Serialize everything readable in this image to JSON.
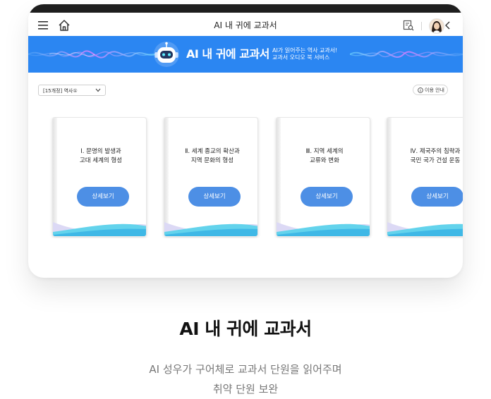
{
  "appbar": {
    "title": "AI 내 귀에 교과서",
    "icons": [
      "menu-icon",
      "home-icon",
      "search-doc-icon",
      "avatar",
      "chevron-left-icon"
    ]
  },
  "banner": {
    "title": "AI 내 귀에 교과서",
    "subtitle_line1": "AI가 읽어주는 역사 교과서!",
    "subtitle_line2": "교과서 오디오 북 서비스"
  },
  "toolbar": {
    "select_value": "[15개정] 역사①",
    "guide_label": "이용 안내"
  },
  "cards": [
    {
      "title": "Ⅰ. 문명의 발생과\n고대 세계의 형성",
      "button": "상세보기"
    },
    {
      "title": "Ⅱ. 세계 종교의 확산과\n지역 문화의 형성",
      "button": "상세보기"
    },
    {
      "title": "Ⅲ. 지역 세계의\n교류와 변화",
      "button": "상세보기"
    },
    {
      "title": "Ⅳ. 제국주의 침략과\n국민 국가 건설 운동",
      "button": "상세보기"
    }
  ],
  "footer": {
    "headline": "AI 내 귀에 교과서",
    "desc_line1": "AI 성우가 구어체로 교과서 단원을 읽어주며",
    "desc_line2": "취약 단원 보완"
  },
  "colors": {
    "banner": "#2b86f2",
    "button": "#4d8fe5",
    "frame_top": "#1e1e1e"
  }
}
